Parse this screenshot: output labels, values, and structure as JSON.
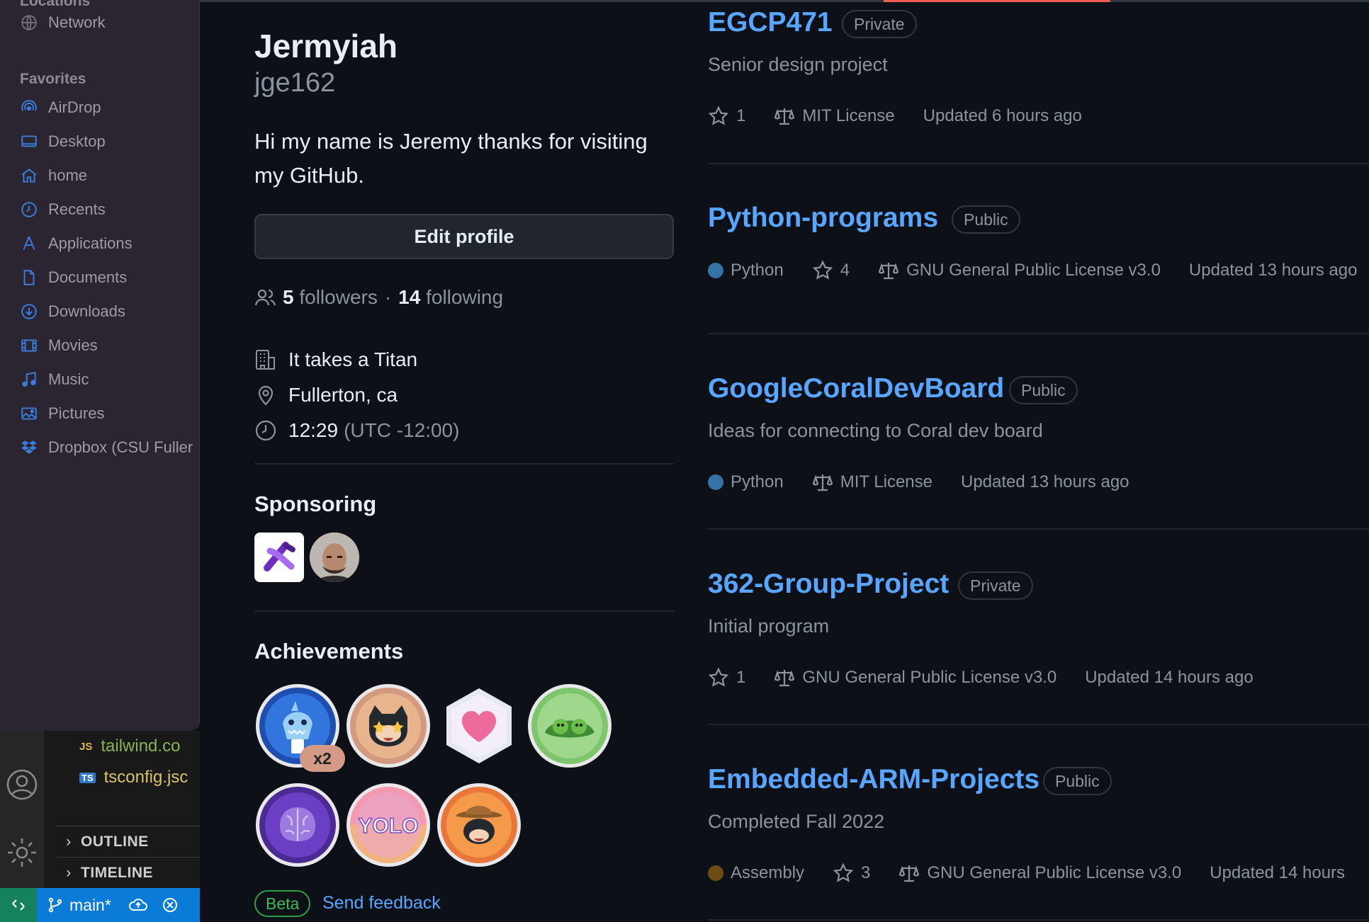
{
  "finder": {
    "locations_label": "Locations",
    "favorites_label": "Favorites",
    "network": "Network",
    "items": [
      {
        "label": "AirDrop",
        "icon": "airdrop-icon"
      },
      {
        "label": "Desktop",
        "icon": "desktop-icon"
      },
      {
        "label": "home",
        "icon": "home-icon"
      },
      {
        "label": "Recents",
        "icon": "clock-icon"
      },
      {
        "label": "Applications",
        "icon": "applications-icon"
      },
      {
        "label": "Documents",
        "icon": "document-icon"
      },
      {
        "label": "Downloads",
        "icon": "download-icon"
      },
      {
        "label": "Movies",
        "icon": "film-icon"
      },
      {
        "label": "Music",
        "icon": "music-note-icon"
      },
      {
        "label": "Pictures",
        "icon": "photo-icon"
      },
      {
        "label": "Dropbox (CSU Fuller",
        "icon": "dropbox-icon"
      }
    ],
    "accent_color": "#3b7ddd"
  },
  "vscode": {
    "files": [
      {
        "badge": "JS",
        "name": "tailwind.co",
        "color": "#d7ba4a",
        "text_color": "#89b359"
      },
      {
        "badge": "TS",
        "name": "tsconfig.jsc",
        "color": "#3178c6",
        "text_color": "#d9c36a"
      }
    ],
    "outline": "OUTLINE",
    "timeline": "TIMELINE",
    "branch": "main*",
    "status_color": "#0a7bd6"
  },
  "profile": {
    "name": "Jermyiah",
    "login": "jge162",
    "bio": "Hi my name is Jeremy thanks for visiting my GitHub.",
    "edit_profile": "Edit profile",
    "followers_count": "5",
    "followers_label": "followers",
    "dot": "·",
    "following_count": "14",
    "following_label": "following",
    "company": "It takes a Titan",
    "location": "Fullerton, ca",
    "time": "12:29",
    "timezone": "(UTC -12:00)",
    "sponsoring_title": "Sponsoring",
    "achievements_title": "Achievements",
    "achievement_multiplier": "x2",
    "achievement_yolo": "YOLO",
    "beta": "Beta",
    "send_feedback": "Send feedback"
  },
  "repos": [
    {
      "name": "EGCP471",
      "visibility": "Private",
      "description": "Senior design project",
      "language": "",
      "lang_color": "",
      "stars": "1",
      "license": "MIT License",
      "updated": "Updated 6 hours ago"
    },
    {
      "name": "Python-programs",
      "visibility": "Public",
      "description": "",
      "language": "Python",
      "lang_color": "#3572A5",
      "stars": "4",
      "license": "GNU General Public License v3.0",
      "updated": "Updated 13 hours ago"
    },
    {
      "name": "GoogleCoralDevBoard",
      "visibility": "Public",
      "description": "Ideas for connecting to Coral dev board",
      "language": "Python",
      "lang_color": "#3572A5",
      "stars": "",
      "license": "MIT License",
      "updated": "Updated 13 hours ago"
    },
    {
      "name": "362-Group-Project",
      "visibility": "Private",
      "description": "Initial program",
      "language": "",
      "lang_color": "",
      "stars": "1",
      "license": "GNU General Public License v3.0",
      "updated": "Updated 14 hours ago"
    },
    {
      "name": "Embedded-ARM-Projects",
      "visibility": "Public",
      "description": "Completed Fall 2022",
      "language": "Assembly",
      "lang_color": "#6E4C13",
      "stars": "3",
      "license": "GNU General Public License v3.0",
      "updated": "Updated 14 hours"
    }
  ],
  "colors": {
    "link": "#58a6ff",
    "muted": "#8b949e",
    "background": "#0d1117",
    "border": "#30363d",
    "beta_green": "#3fb950"
  }
}
